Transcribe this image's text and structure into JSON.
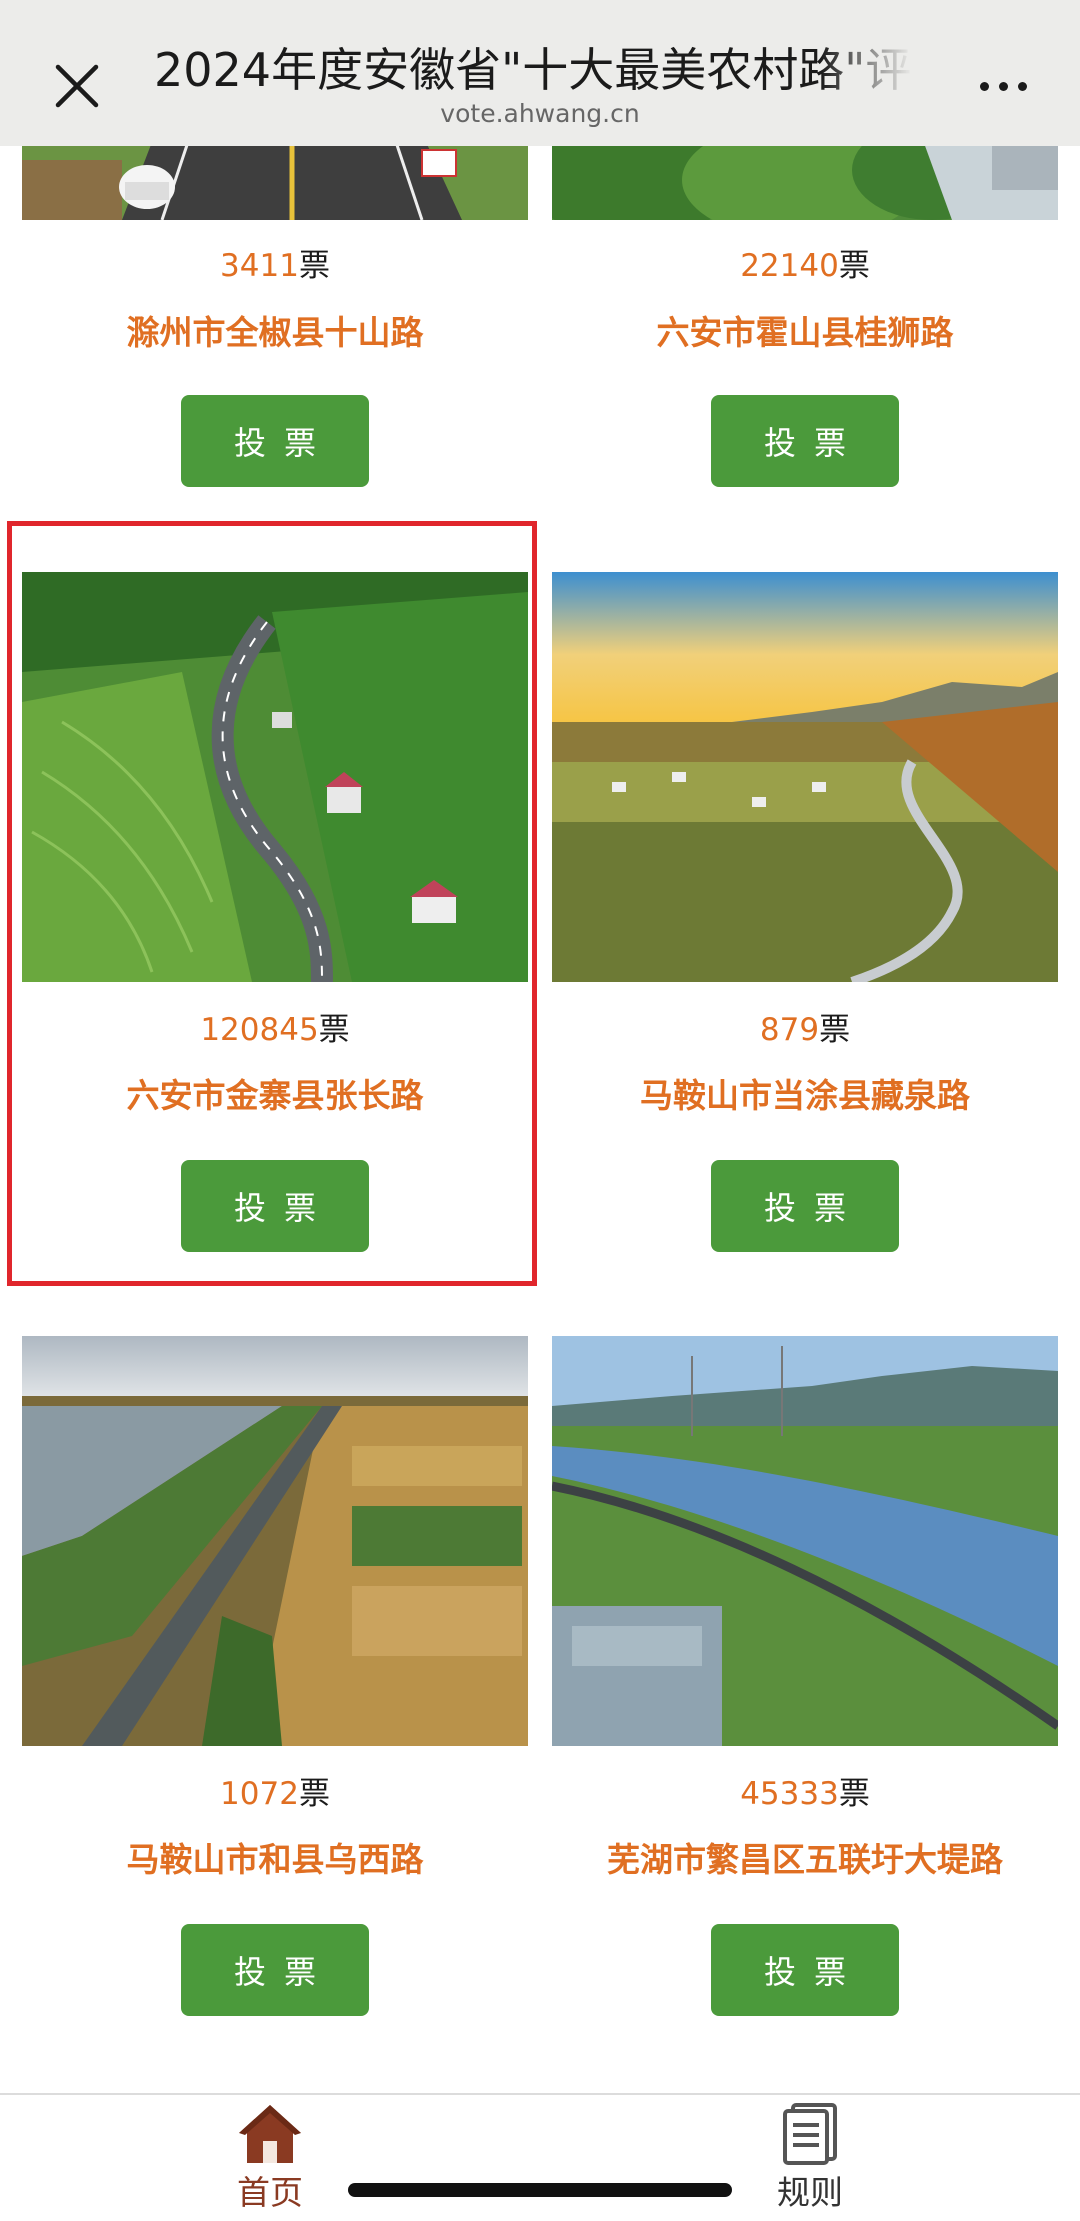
{
  "header": {
    "title": "2024年度安徽省\"十大最美农村路\"评",
    "subtitle": "vote.ahwang.cn",
    "close_icon": "close-icon",
    "more_icon": "more-dots-icon"
  },
  "vote_button_label": "投票",
  "vote_unit": "票",
  "cards": [
    {
      "votes": "3411",
      "name": "滁州市全椒县十山路"
    },
    {
      "votes": "22140",
      "name": "六安市霍山县桂狮路"
    },
    {
      "votes": "120845",
      "name": "六安市金寨县张长路"
    },
    {
      "votes": "879",
      "name": "马鞍山市当涂县藏泉路"
    },
    {
      "votes": "1072",
      "name": "马鞍山市和县乌西路"
    },
    {
      "votes": "45333",
      "name": "芜湖市繁昌区五联圩大堤路"
    }
  ],
  "bottom_nav": [
    {
      "label": "首页",
      "icon": "home-icon"
    },
    {
      "label": "规则",
      "icon": "rules-document-icon"
    }
  ],
  "colors": {
    "accent_orange": "#e06f22",
    "button_green": "#4b9a3b",
    "highlight_red": "#e0262c",
    "nav_active": "#8a3a22"
  }
}
